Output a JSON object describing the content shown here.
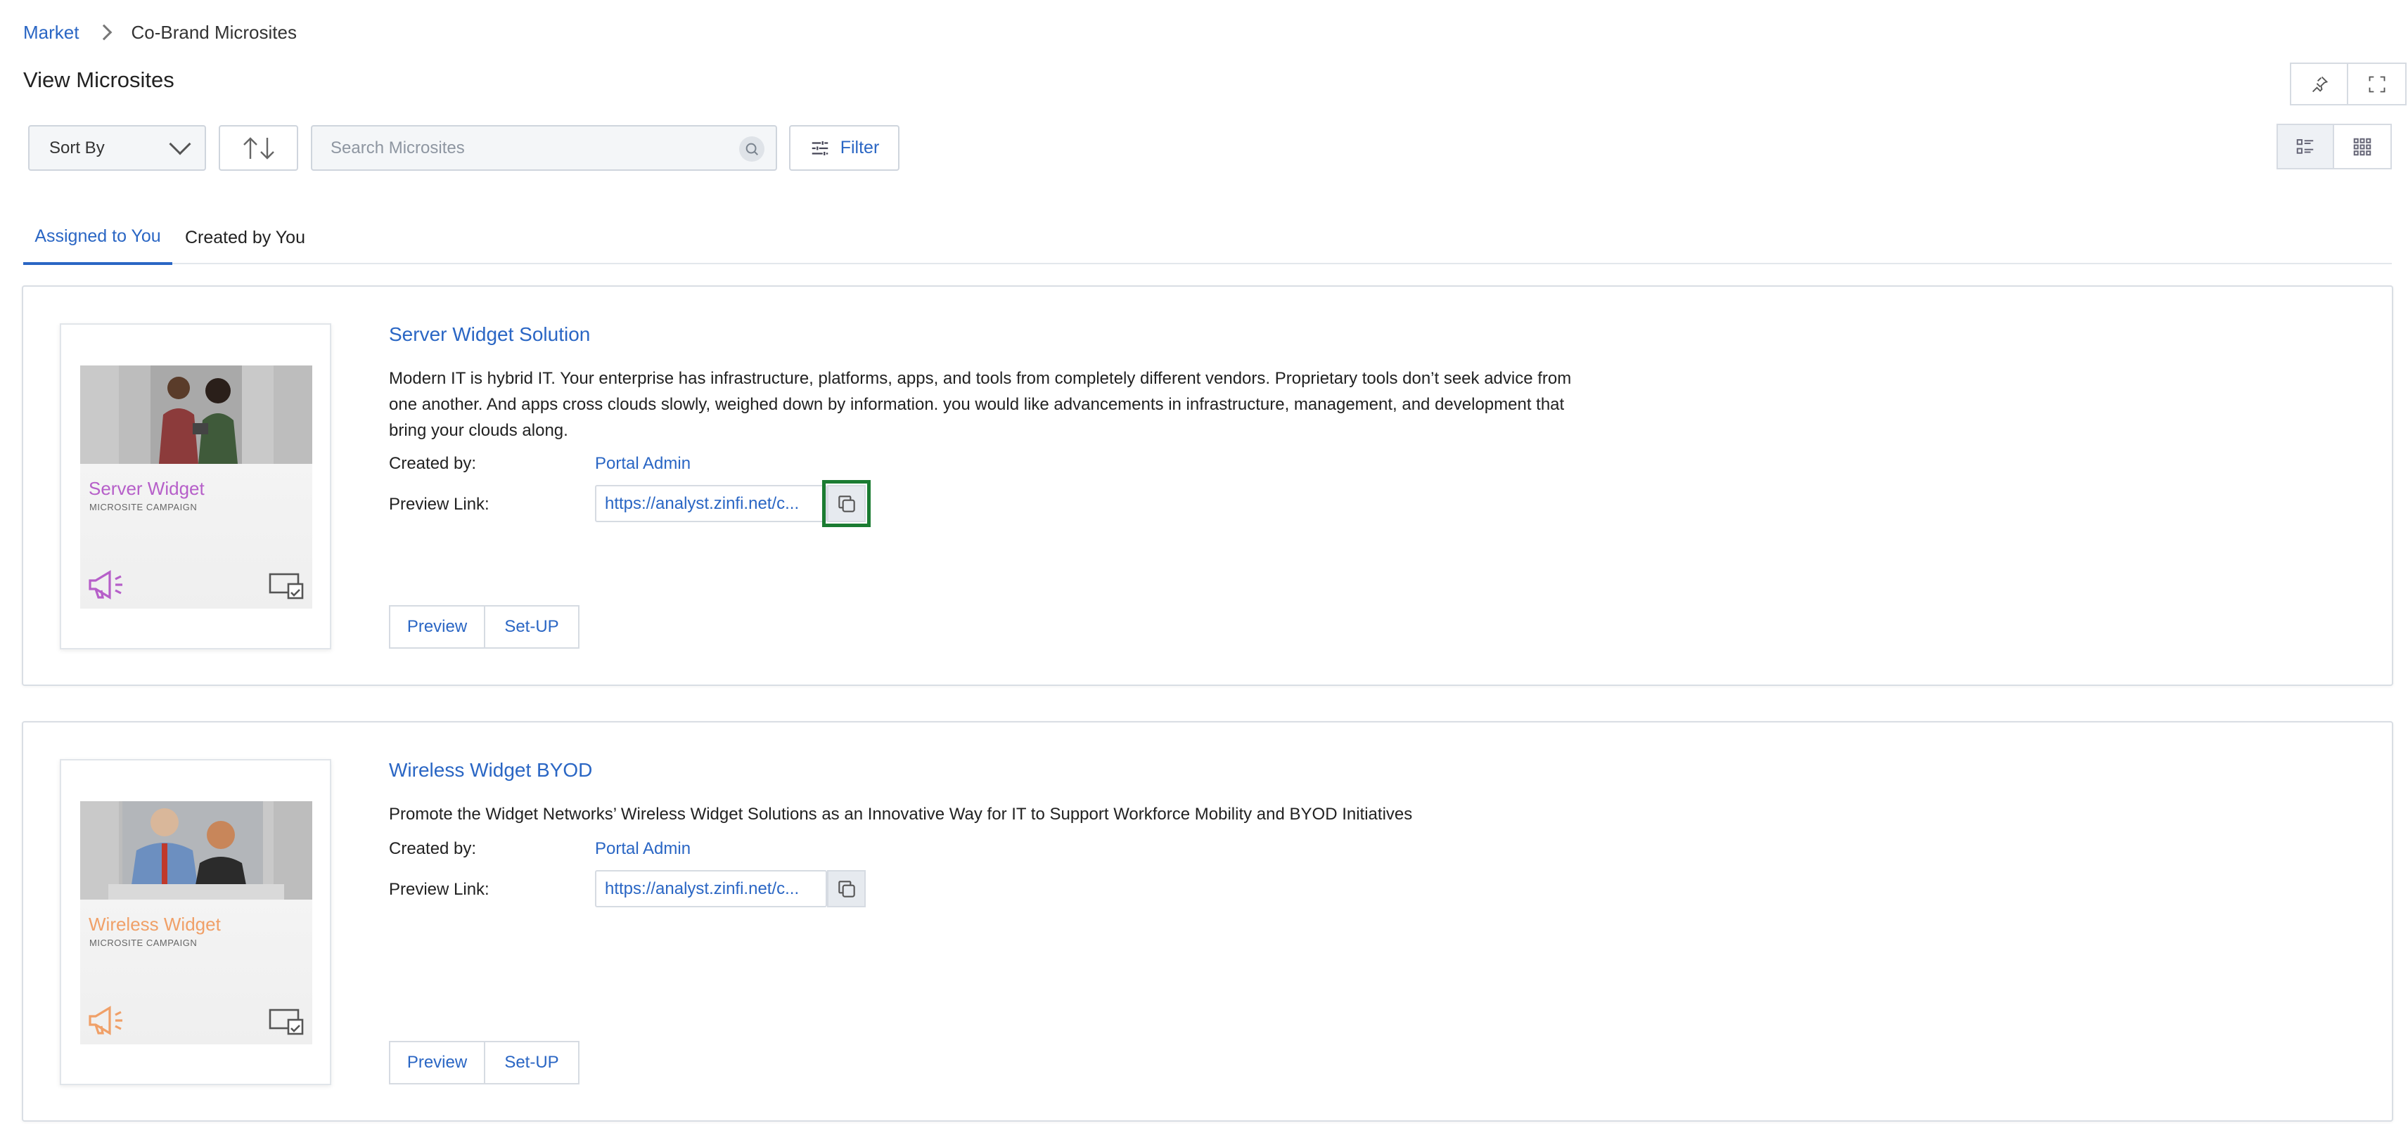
{
  "breadcrumb": {
    "root": "Market",
    "current": "Co-Brand Microsites"
  },
  "page": {
    "title": "View Microsites"
  },
  "toolbar": {
    "sort_label": "Sort By",
    "search_placeholder": "Search Microsites",
    "filter_label": "Filter"
  },
  "tabs": [
    {
      "label": "Assigned to You",
      "active": true
    },
    {
      "label": "Created by You",
      "active": false
    }
  ],
  "labels": {
    "created_by": "Created by:",
    "preview_link": "Preview Link:",
    "preview": "Preview",
    "setup": "Set-UP"
  },
  "microsites": [
    {
      "title": "Server Widget Solution",
      "description": "Modern IT is hybrid IT. Your enterprise has infrastructure, platforms, apps, and tools from completely different vendors. Proprietary tools don’t seek advice from one another. And apps cross clouds slowly, weighed down by information. you would like advancements in infrastructure, management, and development that bring your clouds along.",
      "created_by": "Portal Admin",
      "preview_link": "https://analyst.zinfi.net/c...",
      "thumb_title": "Server Widget",
      "thumb_subtitle": "MICROSITE CAMPAIGN",
      "thumb_color": "#b65fc9"
    },
    {
      "title": "Wireless Widget BYOD",
      "description": "Promote the Widget Networks’ Wireless Widget Solutions as an Innovative Way for IT to Support Workforce Mobility and BYOD Initiatives",
      "created_by": "Portal Admin",
      "preview_link": "https://analyst.zinfi.net/c...",
      "thumb_title": "Wireless Widget",
      "thumb_subtitle": "MICROSITE CAMPAIGN",
      "thumb_color": "#f0a068"
    }
  ],
  "colors": {
    "accent": "#2a66c4",
    "highlight": "#1b7c32"
  }
}
